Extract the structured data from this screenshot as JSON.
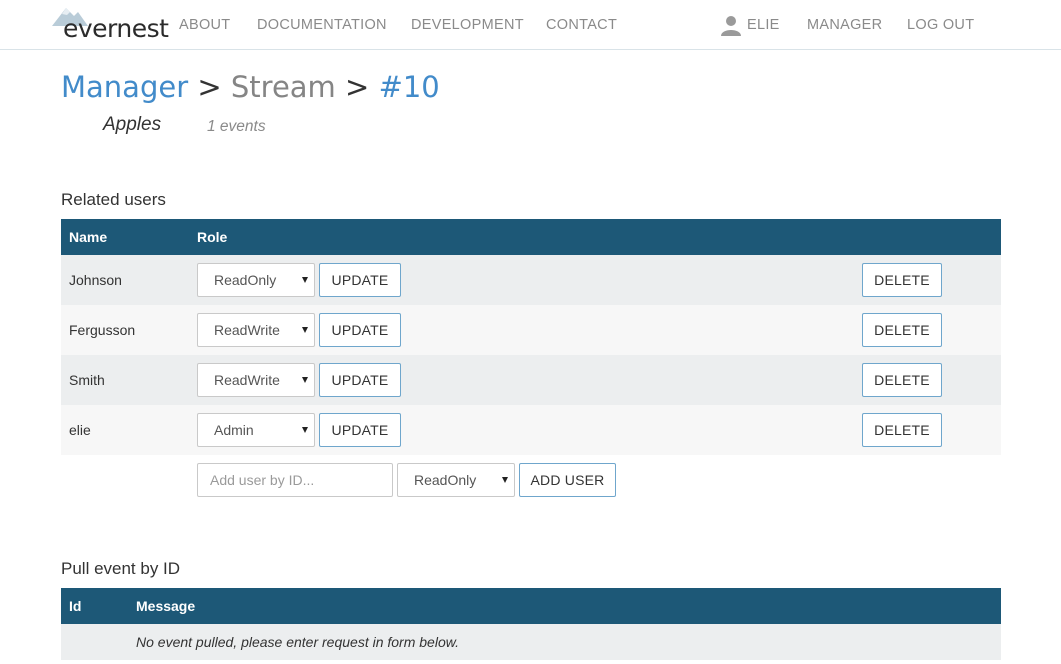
{
  "nav": {
    "logo_text": "evernest",
    "links": [
      "ABOUT",
      "DOCUMENTATION",
      "DEVELOPMENT",
      "CONTACT"
    ],
    "user_name": "ELIE",
    "manager": "MANAGER",
    "logout": "LOG OUT"
  },
  "breadcrumb": {
    "manager": "Manager",
    "sep1": ">",
    "stream": "Stream",
    "sep2": ">",
    "id": "#10"
  },
  "stream": {
    "name": "Apples",
    "events": "1 events"
  },
  "related_users": {
    "title": "Related users",
    "columns": [
      "Name",
      "Role"
    ],
    "update_label": "UPDATE",
    "delete_label": "DELETE",
    "rows": [
      {
        "name": "Johnson",
        "role": "ReadOnly"
      },
      {
        "name": "Fergusson",
        "role": "ReadWrite"
      },
      {
        "name": "Smith",
        "role": "ReadWrite"
      },
      {
        "name": "elie",
        "role": "Admin"
      }
    ],
    "add": {
      "placeholder": "Add user by ID...",
      "role": "ReadOnly",
      "button": "ADD USER"
    }
  },
  "pull_event": {
    "title": "Pull event by ID",
    "columns": [
      "Id",
      "Message"
    ],
    "empty_message": "No event pulled, please enter request in form below."
  }
}
